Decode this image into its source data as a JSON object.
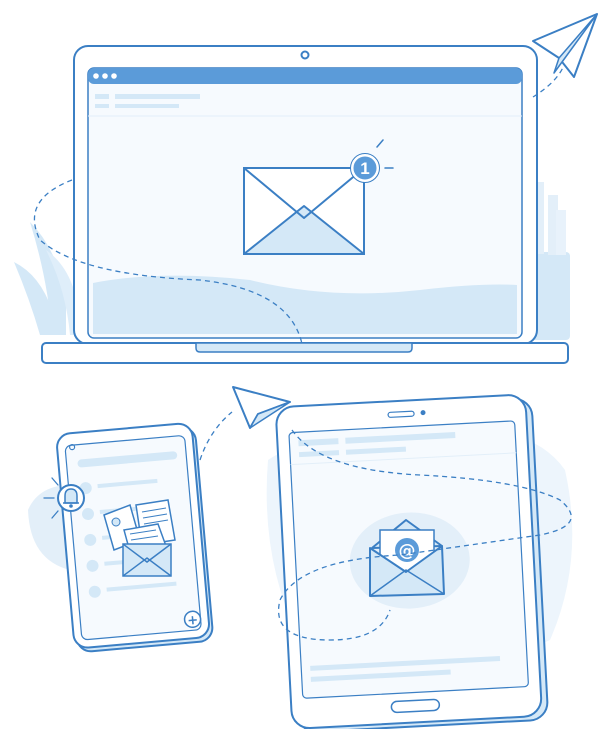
{
  "laptop": {
    "notification_count": "1",
    "window_controls": [
      "dot",
      "dot",
      "dot"
    ]
  },
  "tablet": {
    "email_symbol": "@"
  },
  "phone": {
    "fab_symbol": "+"
  },
  "colors": {
    "stroke": "#3b7fc4",
    "fill_light": "#d4e8f7",
    "fill_pale": "#e8f2fb",
    "badge": "#5b9bd9",
    "background": "#ffffff"
  },
  "icons": [
    "paper-plane-icon",
    "envelope-icon",
    "notification-badge",
    "bell-icon",
    "open-envelope-at-icon",
    "plus-icon"
  ]
}
